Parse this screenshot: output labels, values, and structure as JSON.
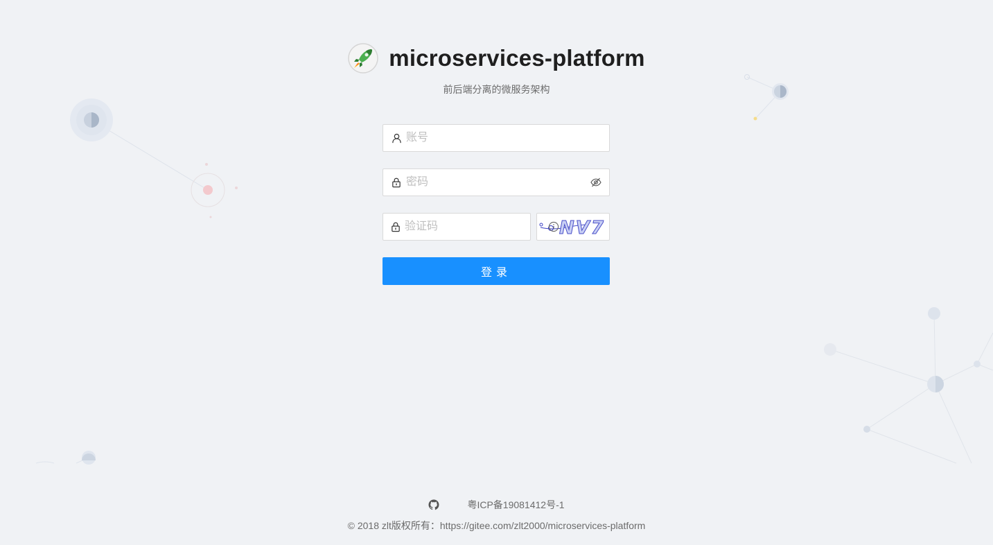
{
  "header": {
    "title": "microservices-platform",
    "subtitle": "前后端分离的微服务架构"
  },
  "form": {
    "username": {
      "placeholder": "账号",
      "value": "",
      "icon": "user-icon"
    },
    "password": {
      "placeholder": "密码",
      "value": "",
      "icon": "lock-icon",
      "toggle_icon": "eye-invisible-icon"
    },
    "captcha": {
      "placeholder": "验证码",
      "value": "",
      "icon": "lock-icon",
      "info_icon": "info-circle-icon",
      "image_text": "NV7"
    },
    "submit_label": "登录"
  },
  "footer": {
    "github_icon": "github-icon",
    "icp": "粤ICP备19081412号-1",
    "copyright": "© 2018 zlt版权所有：https://gitee.com/zlt2000/microservices-platform"
  },
  "colors": {
    "background": "#f0f2f5",
    "primary": "#1890ff",
    "border": "#d9d9d9"
  }
}
